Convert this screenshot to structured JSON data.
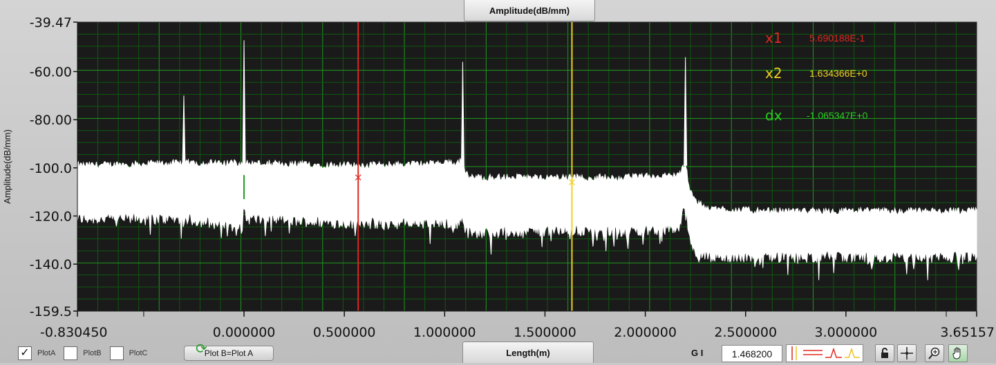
{
  "chart_data": {
    "type": "line",
    "title": "Amplitude(dB/mm)",
    "xlabel": "Length(m)",
    "ylabel": "Amplitude(dB/mm)",
    "xlim": [
      -0.83045,
      3.65157
    ],
    "ylim": [
      -159.5,
      -39.47
    ],
    "x_tick_values": [
      -0.83045,
      0.0,
      0.5,
      1.0,
      1.5,
      2.0,
      2.5,
      3.0,
      3.65157
    ],
    "x_tick_labels": [
      "-0.830450",
      "0.000000",
      "0.500000",
      "1.000000",
      "1.500000",
      "2.000000",
      "2.500000",
      "3.000000",
      "3.65157"
    ],
    "y_tick_values": [
      -39.47,
      -60.0,
      -80.0,
      -100.0,
      -120.0,
      -140.0,
      -159.5
    ],
    "y_tick_labels": [
      "-39.47",
      "-60.00",
      "-80.00",
      "-100.0",
      "-120.0",
      "-140.0",
      "-159.5"
    ],
    "grid": true,
    "series": [
      {
        "name": "PlotA",
        "color": "#ffffff",
        "envelope": {
          "x": [
            -0.83045,
            -0.3,
            -0.01,
            0.0,
            0.01,
            0.55,
            1.07,
            1.09,
            1.1,
            1.12,
            1.5,
            1.9,
            2.17,
            2.2,
            2.22,
            2.26,
            2.35,
            2.6,
            3.0,
            3.4,
            3.65157
          ],
          "upper": [
            -99,
            -98,
            -98,
            -97,
            -98,
            -99,
            -98,
            -96,
            -101,
            -104,
            -104,
            -104,
            -103,
            -98,
            -108,
            -115,
            -117,
            -118,
            -118,
            -118,
            -118
          ],
          "lower": [
            -122,
            -122,
            -126,
            -117,
            -122,
            -124,
            -124,
            -121,
            -126,
            -128,
            -127,
            -127,
            -126,
            -115,
            -130,
            -137,
            -138,
            -138,
            -138,
            -138,
            -138
          ]
        },
        "spikes": [
          {
            "x": -0.3,
            "y": -70
          },
          {
            "x": 0.0,
            "y": -47
          },
          {
            "x": 1.09,
            "y": -56
          },
          {
            "x": 2.2,
            "y": -54
          }
        ]
      }
    ],
    "cursors": [
      {
        "name": "x1",
        "x": 0.5690188,
        "color": "#e0281e",
        "value_label": "5.690188E-1"
      },
      {
        "name": "x2",
        "x": 1.634366,
        "color": "#f0d020",
        "value_label": "1.634366E+0"
      }
    ],
    "delta": {
      "name": "dx",
      "color": "#28d020",
      "value_label": "-1.065347E+0"
    },
    "colors": {
      "plot_bg": "#1a1a1a",
      "grid_major": "#1f9a1f",
      "grid_minor": "#0f5a0f"
    }
  },
  "legend": {
    "plots": [
      {
        "label": "PlotA",
        "checked": true,
        "mark": "✓"
      },
      {
        "label": "PlotB",
        "checked": false,
        "mark": ""
      },
      {
        "label": "PlotC",
        "checked": false,
        "mark": ""
      }
    ],
    "copy_button": "Plot B=Plot A"
  },
  "toolbar": {
    "gi_label": "G I",
    "gi_value": "1.468200",
    "icons": [
      "lock-icon",
      "crosshair-icon",
      "zoom-icon",
      "pan-hand-icon"
    ]
  }
}
